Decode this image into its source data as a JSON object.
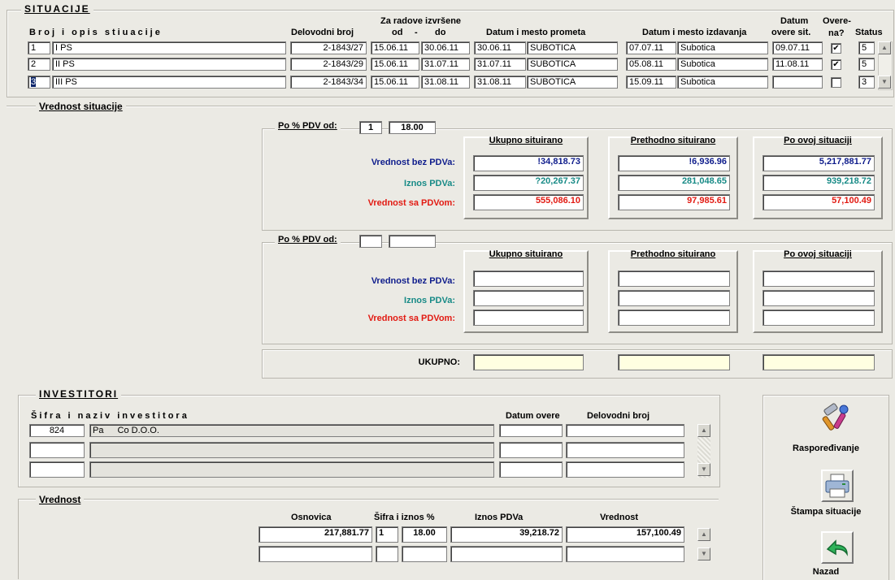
{
  "situacije": {
    "title": "SITUACIJE",
    "headers": {
      "broj_opis": "Broj i opis stiuacije",
      "delovodni": "Delovodni broj",
      "za_radove": "Za radove izvršene",
      "od": "od",
      "dash": "-",
      "do": "do",
      "datum_prometa": "Datum i mesto prometa",
      "datum_izdavanja": "Datum i mesto izdavanja",
      "datum_top": "Datum",
      "datum_bottom": "overe sit.",
      "overena_top": "Overe-",
      "overena_bottom": "na?",
      "status": "Status"
    },
    "rows": [
      {
        "num": "1",
        "desc": "I PS",
        "delovodni": "2-1843/27",
        "od": "15.06.11",
        "do": "30.06.11",
        "promet_datum": "30.06.11",
        "promet_mesto": "SUBOTICA",
        "izd_datum": "07.07.11",
        "izd_mesto": "Subotica",
        "overa": "09.07.11",
        "checked": "✔",
        "status": "5"
      },
      {
        "num": "2",
        "desc": "II PS",
        "delovodni": "2-1843/29",
        "od": "15.06.11",
        "do": "31.07.11",
        "promet_datum": "31.07.11",
        "promet_mesto": "SUBOTICA",
        "izd_datum": "05.08.11",
        "izd_mesto": "Subotica",
        "overa": "11.08.11",
        "checked": "✔",
        "status": "5"
      },
      {
        "num": "3",
        "desc": "III PS",
        "delovodni": "2-1843/34",
        "od": "15.06.11",
        "do": "31.08.11",
        "promet_datum": "31.08.11",
        "promet_mesto": "SUBOTICA",
        "izd_datum": "15.09.11",
        "izd_mesto": "Subotica",
        "overa": "",
        "checked": "",
        "status": "3"
      }
    ]
  },
  "vrednost_situacije": {
    "title": "Vrednost situacije",
    "pdv_label": "Po % PDV od:",
    "block1": {
      "pdv_code": "1",
      "pdv_rate": "18.00",
      "cols": [
        "Ukupno situirano",
        "Prethodno situirano",
        "Po ovoj situaciji"
      ],
      "rows": [
        {
          "label": "Vrednost bez PDVa:",
          "values": [
            "!34,818.73",
            "!6,936.96",
            "5,217,881.77"
          ]
        },
        {
          "label": "Iznos PDVa:",
          "values": [
            "?20,267.37",
            "281,048.65",
            "939,218.72"
          ]
        },
        {
          "label": "Vrednost sa PDVom:",
          "values": [
            "555,086.10",
            "97,985.61",
            "57,100.49"
          ]
        }
      ]
    },
    "block2": {
      "pdv_code": "",
      "pdv_rate": "",
      "cols": [
        "Ukupno situirano",
        "Prethodno situirano",
        "Po ovoj situaciji"
      ],
      "rows": [
        {
          "label": "Vrednost bez PDVa:",
          "values": [
            "",
            "",
            ""
          ]
        },
        {
          "label": "Iznos PDVa:",
          "values": [
            "",
            "",
            ""
          ]
        },
        {
          "label": "Vrednost sa PDVom:",
          "values": [
            "",
            "",
            ""
          ]
        }
      ]
    },
    "ukupno_label": "UKUPNO:"
  },
  "investitori": {
    "title": "INVESTITORI",
    "headers": {
      "sifra_naziv": "Šifra i naziv investitora",
      "datum_overe": "Datum overe",
      "delovodni": "Delovodni broj"
    },
    "rows": [
      {
        "sifra": "824",
        "naziv1": "Pa",
        "naziv2": "Co D.O.O.",
        "datum": "",
        "delovodni": ""
      },
      {
        "sifra": "",
        "naziv1": "",
        "naziv2": "",
        "datum": "",
        "delovodni": ""
      },
      {
        "sifra": "",
        "naziv1": "",
        "naziv2": "",
        "datum": "",
        "delovodni": ""
      }
    ]
  },
  "vrednost": {
    "title": "Vrednost",
    "headers": {
      "osnovica": "Osnovica",
      "sifra_iznos": "Šifra i iznos %",
      "iznos_pdva": "Iznos PDVa",
      "vrednost": "Vrednost"
    },
    "rows": [
      {
        "osnovica": "217,881.77",
        "sifra": "1",
        "procenat": "18.00",
        "iznos": "39,218.72",
        "vrednost": "157,100.49"
      },
      {
        "osnovica": "",
        "sifra": "",
        "procenat": "",
        "iznos": "",
        "vrednost": ""
      }
    ]
  },
  "actions": {
    "rasporedivanje": "Raspoređivanje",
    "stampa": "Štampa situacije",
    "nazad": "Nazad"
  }
}
